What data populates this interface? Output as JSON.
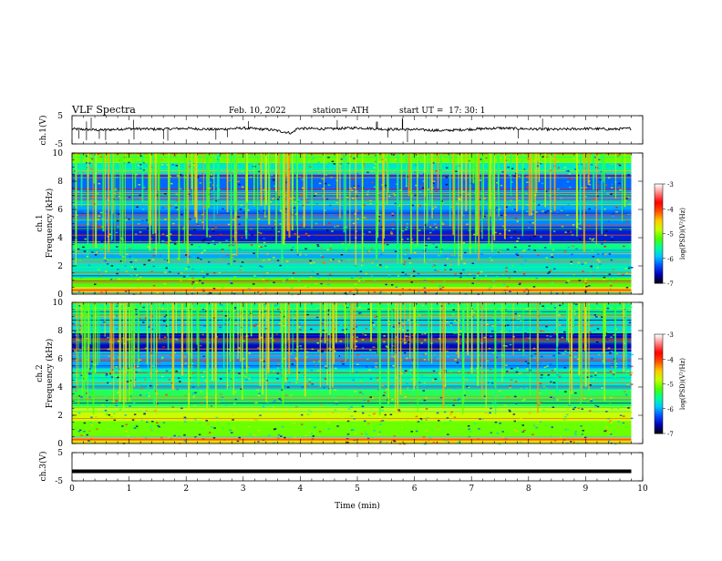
{
  "header": {
    "title": "VLF Spectra",
    "date": "Feb. 10, 2022",
    "station": "station= ATH",
    "start": "start UT =  17: 30: 1"
  },
  "colorbar": {
    "label": "log(PSD)(V²/Hz)",
    "ticks": [
      "-3",
      "-4",
      "-5",
      "-6",
      "-7"
    ],
    "range": [
      -7,
      -3
    ],
    "colors": [
      "#000000",
      "#0000b4",
      "#0050ff",
      "#00c8ff",
      "#00ff96",
      "#50ff00",
      "#c8ff00",
      "#ffc800",
      "#ff5000",
      "#ff0000",
      "#ff8080",
      "#ffffff"
    ]
  },
  "chart_data": [
    {
      "type": "line",
      "panel": "ch1-waveform",
      "ylabel": "ch.1(V)",
      "ylim": [
        -5,
        5
      ],
      "y_ticks": [
        "5",
        "-5"
      ],
      "xlim": [
        0,
        10
      ],
      "x": [
        0,
        0.5,
        1,
        1.5,
        2,
        2.5,
        3,
        3.5,
        3.85,
        3.95,
        4.5,
        5,
        5.5,
        6,
        6.5,
        7,
        7.5,
        8,
        8.5,
        9,
        9.5,
        9.8
      ],
      "y": [
        0.3,
        -0.1,
        0.4,
        0.2,
        0.5,
        0.1,
        0.6,
        0.0,
        -1.2,
        0.5,
        0.3,
        0.7,
        0.2,
        0.1,
        -0.3,
        0.2,
        0.6,
        0.3,
        0.1,
        0.4,
        0.2,
        0.5
      ]
    },
    {
      "type": "heatmap",
      "panel": "ch1-spectrogram",
      "ylabel": "ch.1\nFrequency (kHz)",
      "ylim": [
        0,
        10
      ],
      "y_ticks": [
        "0",
        "2",
        "4",
        "6",
        "8",
        "10"
      ],
      "xlim": [
        0,
        9.8
      ],
      "z_unit": "log(PSD)(V²/Hz)",
      "bands": [
        {
          "f": [
            0.0,
            0.5
          ],
          "level": -4.6
        },
        {
          "f": [
            0.5,
            1.2
          ],
          "level": -5.2
        },
        {
          "f": [
            1.2,
            2.2
          ],
          "level": -5.7
        },
        {
          "f": [
            2.2,
            3.0
          ],
          "level": -6.0
        },
        {
          "f": [
            3.0,
            3.6
          ],
          "level": -5.5
        },
        {
          "f": [
            3.6,
            4.8
          ],
          "level": -6.5
        },
        {
          "f": [
            4.8,
            6.0
          ],
          "level": -6.1
        },
        {
          "f": [
            6.0,
            7.0
          ],
          "level": -6.0
        },
        {
          "f": [
            7.0,
            8.5
          ],
          "level": -6.2
        },
        {
          "f": [
            8.5,
            9.3
          ],
          "level": -5.7
        },
        {
          "f": [
            9.3,
            10.0
          ],
          "level": -5.1
        }
      ]
    },
    {
      "type": "heatmap",
      "panel": "ch2-spectrogram",
      "ylabel": "ch.2\nFrequency (kHz)",
      "ylim": [
        0,
        10
      ],
      "y_ticks": [
        "0",
        "2",
        "4",
        "6",
        "8",
        "10"
      ],
      "xlim": [
        0,
        9.8
      ],
      "z_unit": "log(PSD)(V²/Hz)",
      "bands": [
        {
          "f": [
            0.0,
            0.5
          ],
          "level": -4.6
        },
        {
          "f": [
            0.5,
            1.6
          ],
          "level": -5.1
        },
        {
          "f": [
            1.6,
            2.5
          ],
          "level": -4.8
        },
        {
          "f": [
            2.5,
            3.8
          ],
          "level": -5.4
        },
        {
          "f": [
            3.8,
            4.4
          ],
          "level": -5.7
        },
        {
          "f": [
            4.4,
            5.3
          ],
          "level": -5.6
        },
        {
          "f": [
            5.3,
            6.5
          ],
          "level": -6.0
        },
        {
          "f": [
            6.5,
            7.8
          ],
          "level": -6.6
        },
        {
          "f": [
            7.8,
            9.0
          ],
          "level": -5.8
        },
        {
          "f": [
            9.0,
            10.0
          ],
          "level": -5.5
        }
      ]
    },
    {
      "type": "line",
      "panel": "ch3-waveform",
      "ylabel": "ch.3(V)",
      "xlabel": "Time (min)",
      "ylim": [
        -5,
        5
      ],
      "y_ticks": [
        "5",
        "-5"
      ],
      "xlim": [
        0,
        10
      ],
      "x_ticks": [
        "0",
        "1",
        "2",
        "3",
        "4",
        "5",
        "6",
        "7",
        "8",
        "9",
        "10"
      ],
      "x": [
        0,
        9.8
      ],
      "y": [
        -1.6,
        -1.6
      ]
    }
  ]
}
